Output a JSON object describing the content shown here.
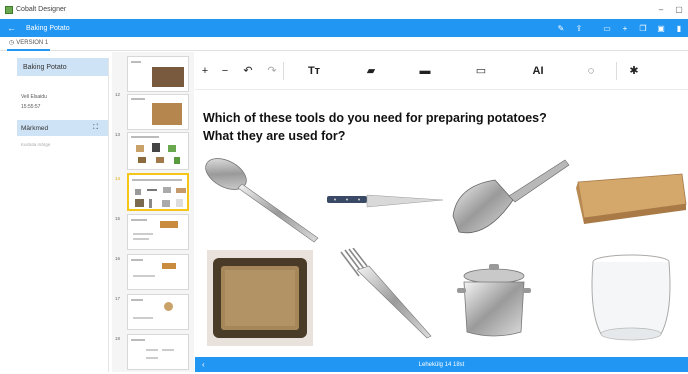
{
  "window": {
    "title": "Cobalt Designer",
    "minimize_glyph": "–",
    "restore_glyph": "▢"
  },
  "header": {
    "back_glyph": "←",
    "doc_title": "Baking Potato",
    "actions": [
      "edit-icon",
      "share-icon",
      "present-icon",
      "add-icon",
      "copy-icon",
      "save-icon",
      "delete-icon"
    ]
  },
  "version": {
    "label": "VERSION 1"
  },
  "sidebar": {
    "title": "Baking Potato",
    "user_name": "Veli Elsaidu",
    "time": "15:55:57",
    "tags_title": "Märkmed",
    "tags_empty": "Kustuta märge"
  },
  "thumbnails": {
    "numbers": [
      "12",
      "13",
      "14",
      "15",
      "16",
      "17",
      "18"
    ],
    "selected": "14"
  },
  "toolbar": {
    "items": [
      {
        "name": "add-icon",
        "glyph": "+"
      },
      {
        "name": "remove-icon",
        "glyph": "−"
      },
      {
        "name": "undo-icon",
        "glyph": "↶"
      },
      {
        "name": "redo-icon",
        "glyph": "↷"
      },
      {
        "name": "text-style-icon",
        "glyph": "Tт"
      },
      {
        "name": "image-icon",
        "glyph": "▰"
      },
      {
        "name": "video-icon",
        "glyph": "▬"
      },
      {
        "name": "embed-icon",
        "glyph": "▭"
      },
      {
        "name": "text-cursor-icon",
        "glyph": "AI"
      },
      {
        "name": "speech-icon",
        "glyph": "◌"
      },
      {
        "name": "settings-icon",
        "glyph": "✱"
      }
    ]
  },
  "slide": {
    "question_line1": "Which of these tools do you need for preparing potatoes?",
    "question_line2": "What they are used for?",
    "images": [
      "spoon",
      "knife",
      "scoop",
      "cutting-board",
      "baking-tray",
      "fork",
      "pot",
      "glass"
    ]
  },
  "footer": {
    "chevron": "‹",
    "page_label": "Lehekülg 14 18st"
  },
  "colors": {
    "accent": "#2196f3",
    "sidebar_highlight": "#cfe3f6",
    "thumb_selected": "#f5c518"
  }
}
